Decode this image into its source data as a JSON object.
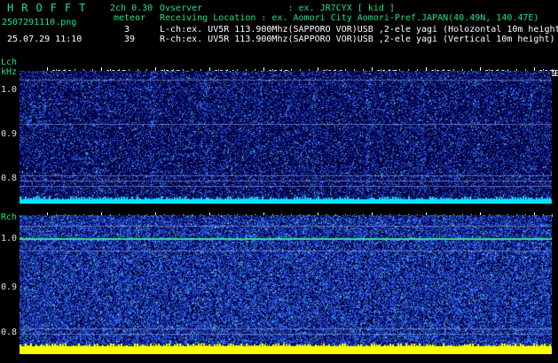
{
  "app": {
    "title_letters": "HROFFT",
    "version": "2ch 0.30",
    "meteor_label": "meteor"
  },
  "file": {
    "filename": "2507291110.png",
    "timestamp": "25.07.29 11:10"
  },
  "meteor_counts": {
    "lch": "3",
    "rch": "39"
  },
  "info": {
    "observer": "Ovserver                : ex. JR7CYX [ kid ]",
    "location": "Receiving Location : ex. Aomori City Aomori-Pref.JAPAN(40.49N, 140.47E)",
    "lch": "L-ch:ex. UV5R 113.900Mhz(SAPPORO VOR)USB ,2-ele yagi (Holozontal 10m height)",
    "rch": "R-ch:ex. UV5R 113.900Mhz(SAPPORO VOR)USB ,2-ele yagi (Vertical 10m height)"
  },
  "time_axis": {
    "labels": [
      "1111",
      "1112",
      "1113",
      "1114",
      "1115",
      "1116",
      "1117",
      "1118",
      "1119",
      "1120",
      "2"
    ]
  },
  "lch_panel": {
    "channel_label": "Lch",
    "unit_label": "kHz",
    "freq_ticks": [
      "1.0",
      "0.9",
      "0.8"
    ]
  },
  "rch_panel": {
    "channel_label": "Rch",
    "freq_ticks": [
      "1.0",
      "0.9",
      "0.8"
    ]
  },
  "colors": {
    "header_accent": "#1ce08a",
    "lch_baseline": "#00e8ff",
    "rch_baseline": "#ffff00",
    "spectrogram_base": "#00003a"
  }
}
